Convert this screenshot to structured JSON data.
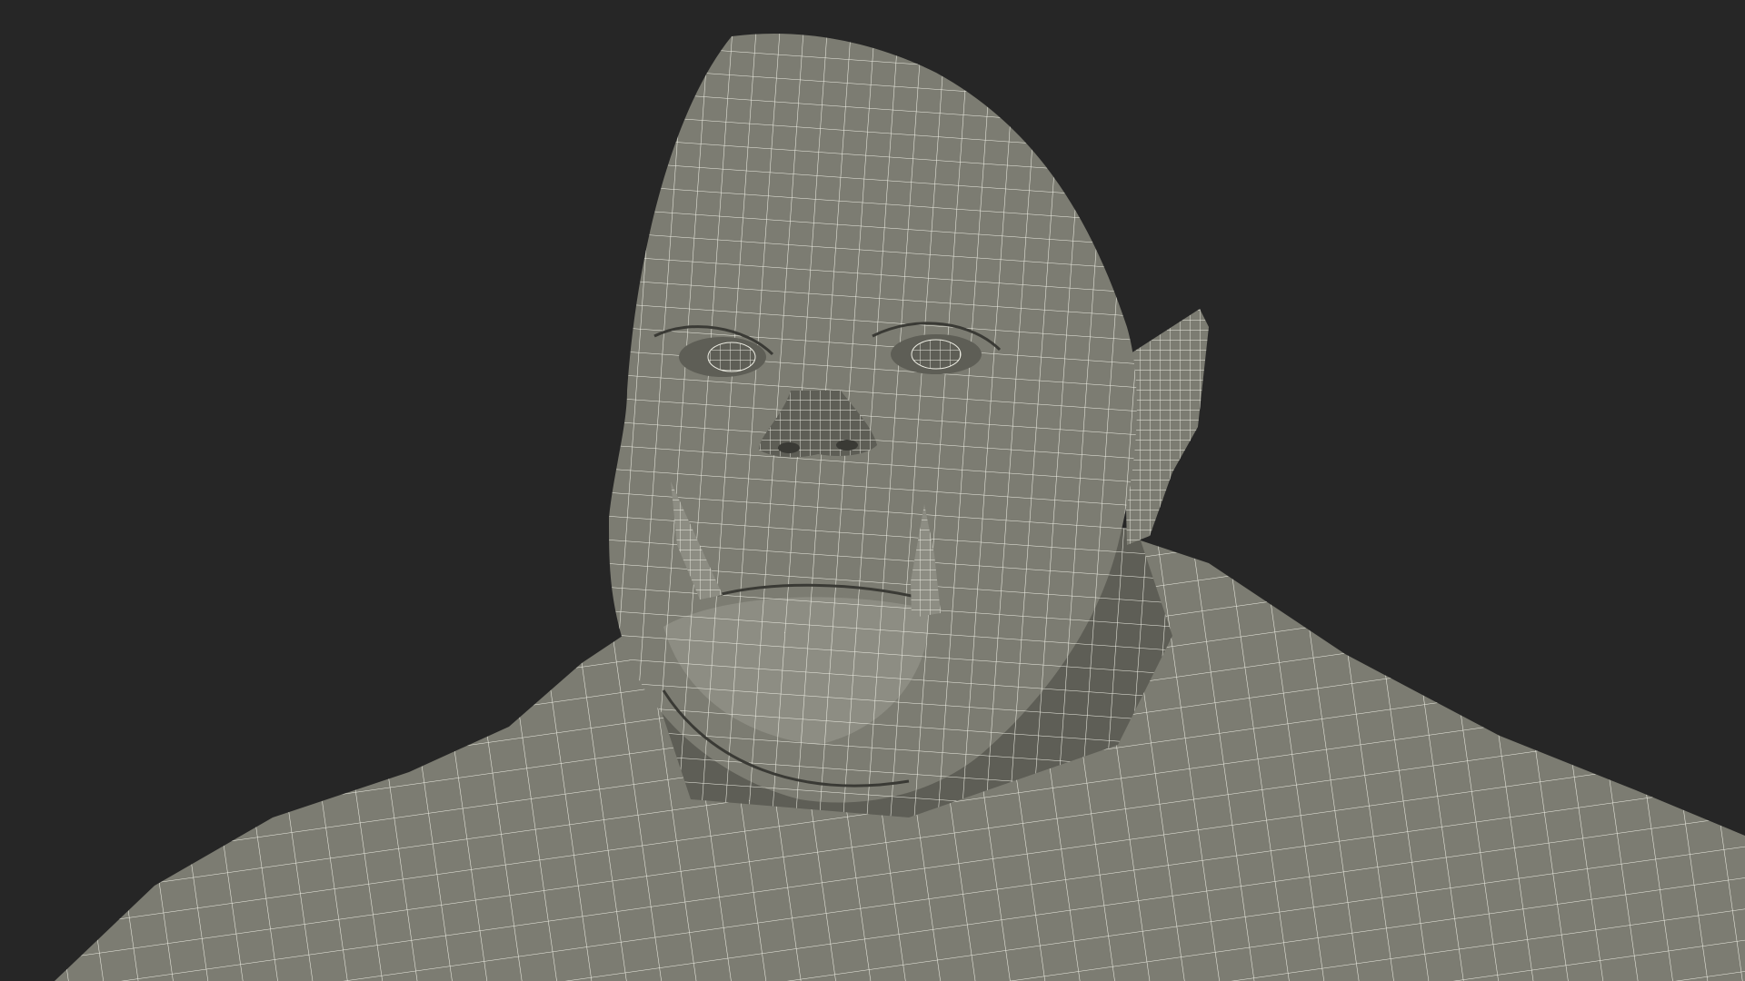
{
  "scene": {
    "subject": "orc-bust-wireframe",
    "view": "front-close-up",
    "shading": "flat-shaded-with-wireframe-overlay",
    "colors": {
      "background": "#262626",
      "surface": "#7c7c72",
      "surface_shadow": "#5e5e56",
      "surface_highlight": "#8d8d83",
      "wire": "#eeeee4",
      "crease": "#3a3a35"
    }
  }
}
